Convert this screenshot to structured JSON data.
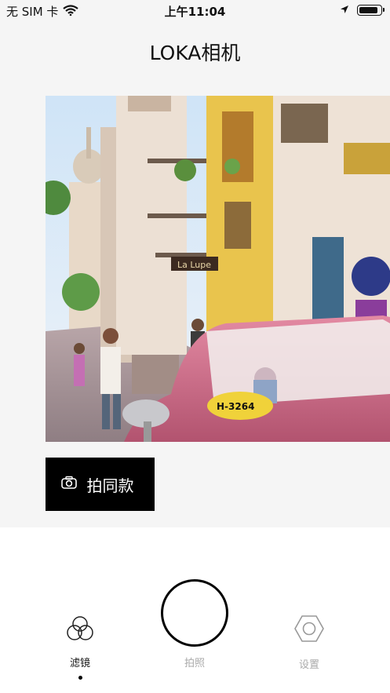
{
  "status_bar": {
    "carrier": "无 SIM 卡",
    "time": "上午11:04",
    "battery_level": 0.9
  },
  "header": {
    "title": "LOKA相机"
  },
  "same_style_button": {
    "label": "拍同款",
    "icon": "camera-icon"
  },
  "tab_bar": {
    "items": [
      {
        "label": "滤镜",
        "icon": "filter-circles-icon",
        "active": true
      },
      {
        "label": "拍照",
        "icon": "shutter-circle",
        "active": false
      },
      {
        "label": "设置",
        "icon": "hexagon-nut-icon",
        "active": false
      }
    ]
  },
  "colors": {
    "active_label": "#111111",
    "inactive_label": "#aaaaaa",
    "background": "#f5f5f5",
    "button_bg": "#000000"
  }
}
